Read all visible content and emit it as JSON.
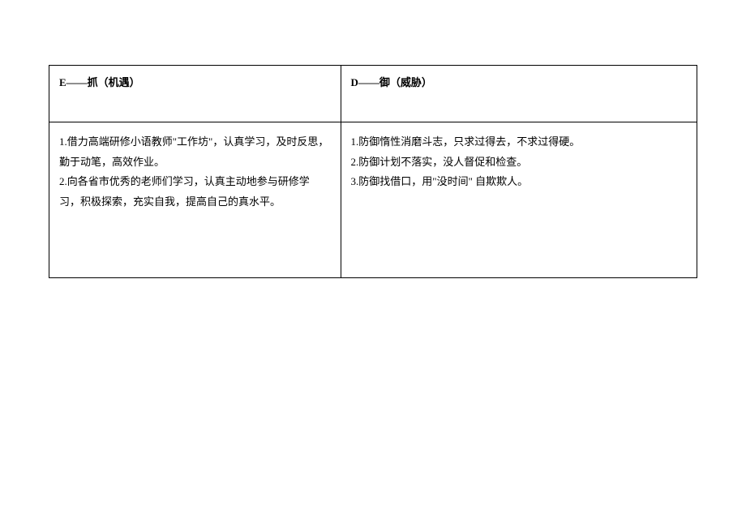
{
  "table": {
    "headers": {
      "left": "E——抓（机遇）",
      "right": "D——御（威胁）"
    },
    "content": {
      "left": {
        "line1": "1.借力高端研修小语教师\"工作坊\"，认真学习，及时反思，勤于动笔，高效作业。",
        "line2": "2.向各省市优秀的老师们学习，认真主动地参与研修学习，积极探索，充实自我，提高自己的真水平。"
      },
      "right": {
        "line1": "1.防御惰性消磨斗志，只求过得去，不求过得硬。",
        "line2": "2.防御计划不落实，没人督促和检查。",
        "line3": "3.防御找借口，用\"没时间\" 自欺欺人。"
      }
    }
  }
}
